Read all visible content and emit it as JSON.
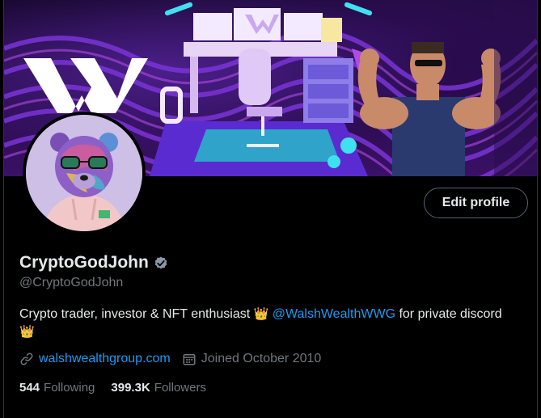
{
  "profile": {
    "display_name": "CryptoGodJohn",
    "handle": "@CryptoGodJohn",
    "bio_text_1": "Crypto trader, investor & NFT enthusiast ",
    "bio_emoji_1": "👑",
    "bio_mention": "@WalshWealthWWG",
    "bio_text_2": " for private discord",
    "bio_emoji_2": "👑",
    "website": "walshwealthgroup.com",
    "joined": "Joined October 2010",
    "following_count": "544",
    "following_label": "Following",
    "followers_count": "399.3K",
    "followers_label": "Followers"
  },
  "actions": {
    "edit_profile_label": "Edit profile"
  },
  "icons": {
    "verified": "verified-badge-icon",
    "link": "link-icon",
    "calendar": "calendar-icon"
  },
  "colors": {
    "accent": "#1d9bf0",
    "muted": "#71767b",
    "text": "#e7e9ea",
    "background": "#000000"
  }
}
